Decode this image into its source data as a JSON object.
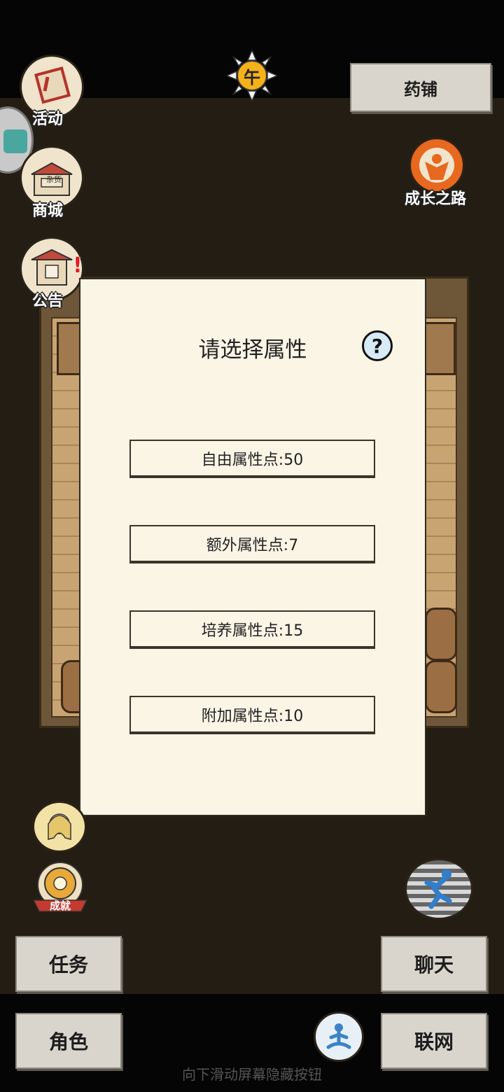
{
  "top": {
    "time_badge": "午",
    "pharmacy_button": "药铺"
  },
  "left_icons": [
    {
      "label": "活动",
      "icon": "banner-icon"
    },
    {
      "label": "商城",
      "icon": "shop-icon",
      "sign": "杂货"
    },
    {
      "label": "公告",
      "icon": "notice-icon"
    }
  ],
  "right_icons": [
    {
      "label": "成长之路",
      "icon": "growth-path-icon"
    }
  ],
  "modal": {
    "title": "请选择属性",
    "help": "?",
    "options": [
      {
        "label": "自由属性点:50"
      },
      {
        "label": "额外属性点:7"
      },
      {
        "label": "培养属性点:15"
      },
      {
        "label": "附加属性点:10"
      }
    ]
  },
  "achievement_badge": "成就",
  "bottom": {
    "task": "任务",
    "chat": "聊天",
    "role": "角色",
    "online": "联网",
    "hint": "向下滑动屏幕隐藏按钮"
  },
  "colors": {
    "modal_bg": "#fbf5e6",
    "page_bg": "#231d13",
    "button_bg": "#d9d5cd"
  }
}
